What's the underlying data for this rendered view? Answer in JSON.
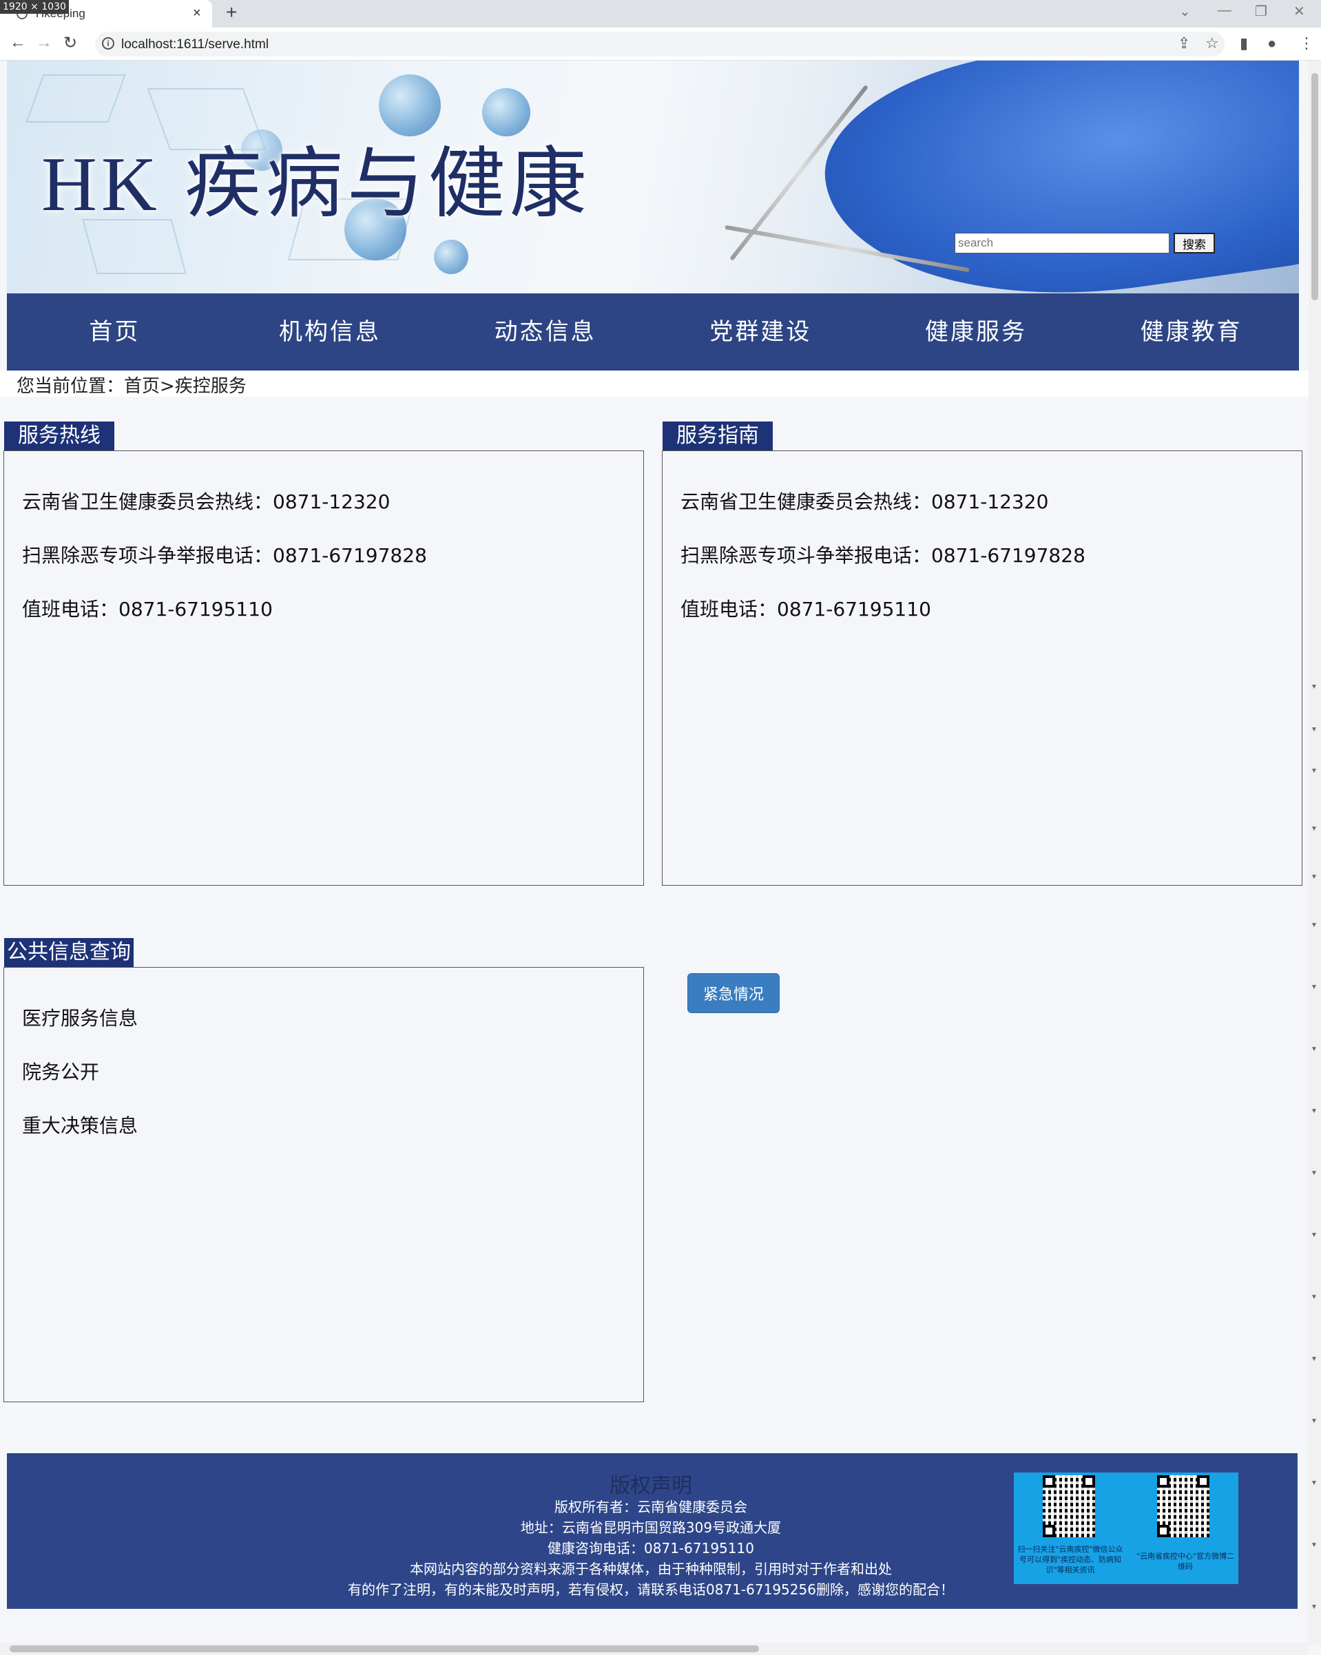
{
  "browser": {
    "size_badge": "1920 × 1030",
    "tab_title": "Hkeeping",
    "tab_close": "×",
    "new_tab": "+",
    "url": "localhost:1611/serve.html",
    "icons": [
      "back-icon",
      "forward-icon",
      "reload-icon",
      "info-icon",
      "share-icon",
      "star-icon",
      "sidepanel-icon",
      "profile-icon",
      "menu-icon"
    ]
  },
  "header": {
    "logo_text": "HK 疾病与健康",
    "search_placeholder": "search",
    "search_button": "搜索"
  },
  "nav": {
    "items": [
      "首页",
      "机构信息",
      "动态信息",
      "党群建设",
      "健康服务",
      "健康教育"
    ]
  },
  "breadcrumb": "您当前位置：首页>疾控服务",
  "panels": {
    "hotline": {
      "title": "服务热线",
      "lines": [
        "云南省卫生健康委员会热线：0871-12320",
        "扫黑除恶专项斗争举报电话：0871-67197828",
        "值班电话：0871-67195110"
      ]
    },
    "guide": {
      "title": "服务指南",
      "lines": [
        "云南省卫生健康委员会热线：0871-12320",
        "扫黑除恶专项斗争举报电话：0871-67197828",
        "值班电话：0871-67195110"
      ]
    },
    "public_info": {
      "title": "公共信息查询",
      "lines": [
        "医疗服务信息",
        "院务公开",
        "重大决策信息"
      ]
    }
  },
  "emergency_button": "紧急情况",
  "footer": {
    "title": "版权声明",
    "lines": [
      "版权所有者：云南省健康委员会",
      "地址：云南省昆明市国贸路309号政通大厦",
      "健康咨询电话：0871-67195110",
      "本网站内容的部分资料来源于各种媒体，由于种种限制，引用时对于作者和出处",
      "有的作了注明，有的未能及时声明，若有侵权，请联系电话0871-67195256删除，感谢您的配合！"
    ],
    "qr_captions": [
      "扫一扫关注\"云南疾控\"微信公众号可以得到\"疾控动态、防病知识\"等相关资讯",
      "\"云南省疾控中心\"官方微博二维码"
    ]
  },
  "colors": {
    "nav_bg": "#2d4584",
    "panel_tab_bg": "#1d3277",
    "footer_bg": "#2e4689",
    "button_blue": "#3a7dc0",
    "page_bg": "#f4f6fa"
  }
}
